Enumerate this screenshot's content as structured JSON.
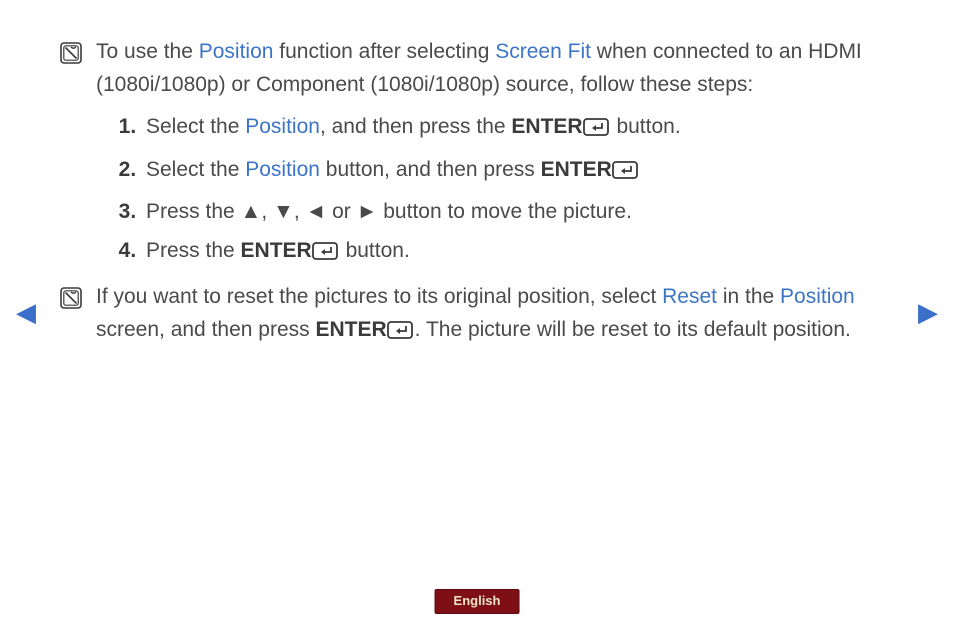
{
  "note1": {
    "p1a": "To use the ",
    "hl1": "Position",
    "p1b": " function after selecting ",
    "hl2": "Screen Fit",
    "p1c": " when connected to an HDMI (1080i/1080p) or Component (1080i/1080p) source, follow these steps:"
  },
  "steps": {
    "s1a": "Select the ",
    "s1hl": "Position",
    "s1b": ", and then press the ",
    "s1enter": "ENTER",
    "s1c": " button.",
    "s2a": "Select the ",
    "s2hl": "Position",
    "s2b": " button, and then press ",
    "s2enter": "ENTER",
    "s3a": "Press the ",
    "s3up": "▲",
    "s3c1": ", ",
    "s3down": "▼",
    "s3c2": ", ",
    "s3left": "◄",
    "s3or": " or ",
    "s3right": "►",
    "s3b": " button to move the picture.",
    "s4a": "Press the ",
    "s4enter": "ENTER",
    "s4b": " button."
  },
  "note2": {
    "p2a": "If you want to reset the pictures to its original position, select ",
    "hl1": "Reset",
    "p2b": " in the ",
    "hl2": "Position",
    "p2c": " screen, and then press ",
    "enter": "ENTER",
    "p2d": ". The picture will be reset to its default position."
  },
  "nav": {
    "prev": "◀",
    "next": "▶"
  },
  "language": "English"
}
